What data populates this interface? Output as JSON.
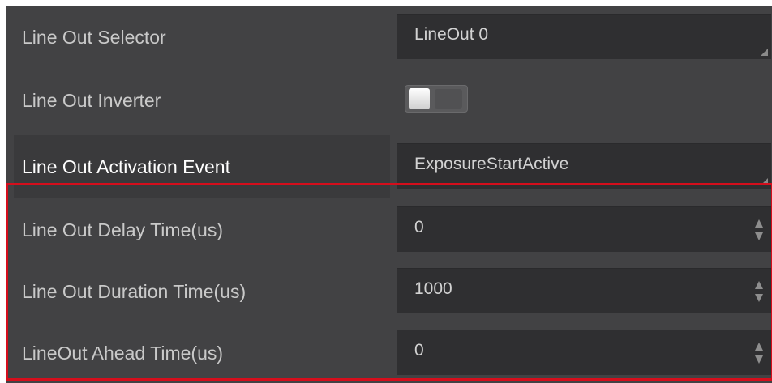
{
  "properties": [
    {
      "label": "Line Out Selector",
      "type": "dropdown",
      "value": "LineOut 0"
    },
    {
      "label": "Line Out Inverter",
      "type": "toggle",
      "value": "off"
    },
    {
      "label": "Line Out Activation Event",
      "type": "dropdown",
      "value": "ExposureStartActive"
    },
    {
      "label": "Line Out Delay Time(us)",
      "type": "spinbox",
      "value": "0"
    },
    {
      "label": "Line Out Duration Time(us)",
      "type": "spinbox",
      "value": "1000"
    },
    {
      "label": "LineOut Ahead Time(us)",
      "type": "spinbox",
      "value": "0"
    }
  ],
  "colors": {
    "panel_bg": "#424244",
    "control_bg": "#2f2f31",
    "highlight_border": "#d50e1c"
  }
}
